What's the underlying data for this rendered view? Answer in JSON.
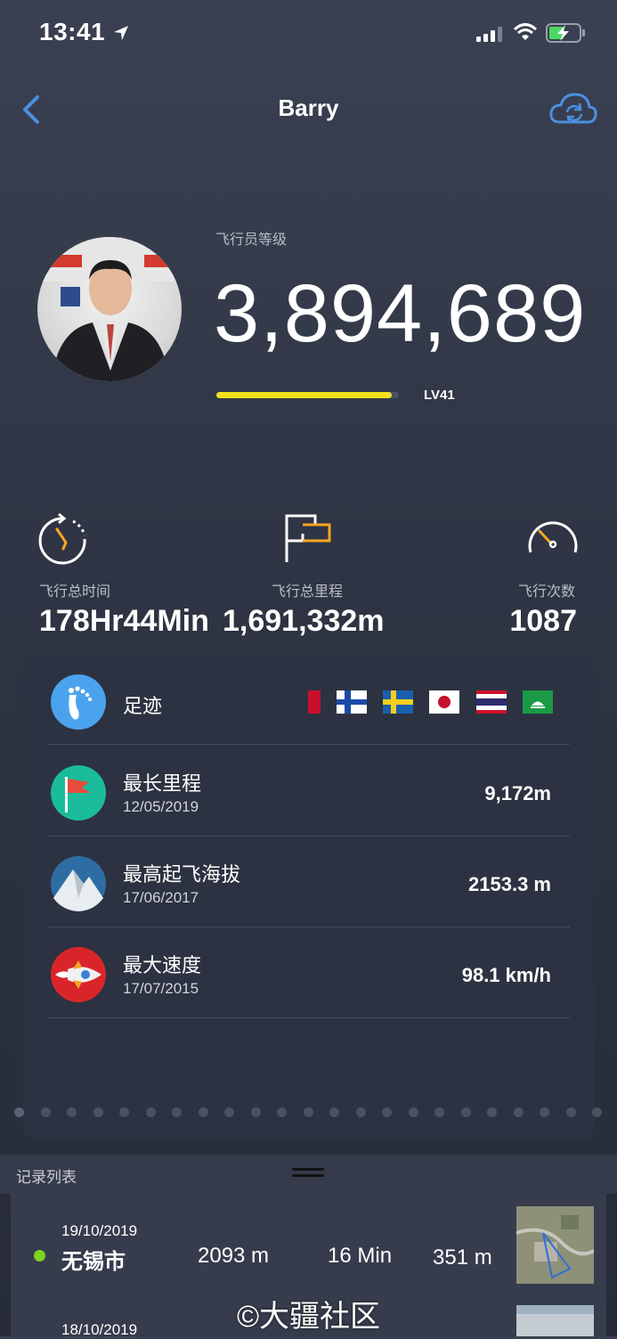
{
  "status_bar": {
    "time": "13:41"
  },
  "header": {
    "title": "Barry",
    "back_icon": "chevron-left-icon",
    "sync_icon": "cloud-sync-icon",
    "accent": "#4a90e2"
  },
  "pilot": {
    "level_label": "飞行员等级",
    "score": "3,894,689",
    "level": "LV41",
    "level_progress": 0.96,
    "bar_color": "#f4e11c"
  },
  "stats": [
    {
      "label": "飞行总时间",
      "value": "178Hr44Min",
      "icon": "stopwatch-icon"
    },
    {
      "label": "飞行总里程",
      "value": "1,691,332m",
      "icon": "flag-icon"
    },
    {
      "label": "飞行次数",
      "value": "1087",
      "icon": "speedometer-icon"
    }
  ],
  "footprints": {
    "label": "足迹",
    "flags": [
      "partial-red-flag",
      "finland-flag",
      "sweden-flag",
      "japan-flag",
      "thailand-flag",
      "macau-flag"
    ]
  },
  "records": [
    {
      "title": "最长里程",
      "date": "12/05/2019",
      "value": "9,172m",
      "icon": "red-flag-badge-icon"
    },
    {
      "title": "最高起飞海拔",
      "date": "17/06/2017",
      "value": "2153.3 m",
      "icon": "mountain-badge-icon"
    },
    {
      "title": "最大速度",
      "date": "17/07/2015",
      "value": "98.1 km/h",
      "icon": "rocket-badge-icon"
    }
  ],
  "pager": {
    "count": 23,
    "active": 0
  },
  "record_list": {
    "title": "记录列表",
    "items": [
      {
        "date": "19/10/2019",
        "place": "无锡市",
        "distance": "2093 m",
        "duration": "16 Min",
        "altitude": "351 m"
      },
      {
        "date": "18/10/2019"
      }
    ]
  },
  "watermark": "©大疆社区"
}
